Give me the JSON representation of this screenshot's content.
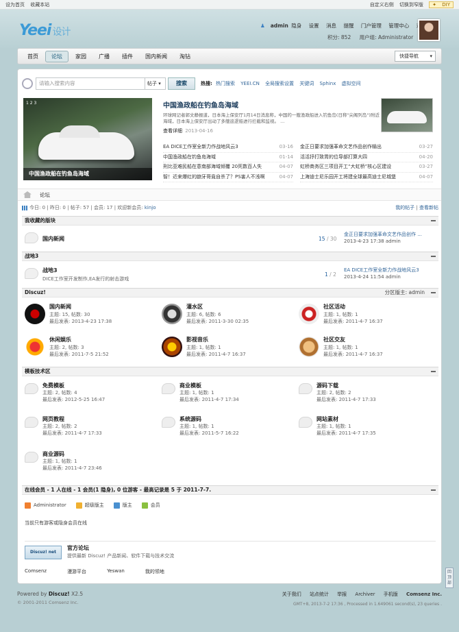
{
  "topbar": {
    "left": [
      "设为首页",
      "收藏本站"
    ],
    "right": [
      "自定义右侧",
      "切换到窄版"
    ],
    "diy": "DIY"
  },
  "header": {
    "logo": "Yeei",
    "logo_sub": "设计",
    "user_menu": [
      "admin",
      "隐身",
      "设置",
      "消息",
      "提醒",
      "门户管理",
      "管理中心",
      "退出"
    ],
    "credits": "积分: 852",
    "group": "用户组: Administrator"
  },
  "nav": {
    "items": [
      "首页",
      "论坛",
      "家园",
      "广播",
      "插件",
      "国内新闻",
      "淘钻"
    ],
    "active": 1,
    "quick": "快捷导航"
  },
  "search": {
    "placeholder": "请输入搜索内容",
    "type": "帖子",
    "button": "搜索",
    "hot_label": "热搜:",
    "hot": [
      "热门搜索",
      "YEEI.CN",
      "全局搜索设置",
      "关键词",
      "Sphinx",
      "虚拟空间"
    ]
  },
  "slide": {
    "pager": "1  2  3",
    "caption": "中国渔政船在钓鱼岛海域"
  },
  "feature": {
    "title": "中国渔政船在钓鱼岛海域",
    "desc": "环球网记者郭文静报道，日本海上保安厅1月14日消息称，中国的一艘渔政船进入钓鱼岛(日称\"尖阁列岛\")附近海域，日本海上保安厅出动了多艘巡逻船进行拦截和监视。 ...",
    "more": "查看详细",
    "date": "2013-04-16"
  },
  "news_left": [
    {
      "t": "EA DICE工作室全新力作战地风云3",
      "d": "03-16"
    },
    {
      "t": "中国渔政船在钓鱼岛海域",
      "d": "01-14"
    },
    {
      "t": "刑比亚难民船在意南部海域倾覆 20死数百人失",
      "d": "04-07"
    },
    {
      "t": "智！近来爆红的龅牙哥竟自杀了？PS害人不浅啊",
      "d": "04-07"
    }
  ],
  "news_right": [
    {
      "t": "金正日要求加强革命文艺作品创作输出",
      "d": "03-27"
    },
    {
      "t": "活活抒打致胃的位导部打算大四",
      "d": "04-20"
    },
    {
      "t": "虹桥商务区三项目开工“大虹桥”核心区建设",
      "d": "03-27"
    },
    {
      "t": "上海迪士尼乐园开工将建全球最高迪士尼城堡",
      "d": "04-07"
    }
  ],
  "breadcrumb": "论坛",
  "stats": {
    "text": "今日: 0  |  昨日: 0  |  帖子: 57  |  会员: 17  |  欢迎新会员: ",
    "new_member": "kinjo",
    "my_posts": "我的帖子",
    "new_posts": "查看新帖"
  },
  "fav": {
    "title": "我收藏的版块",
    "name": "国内新闻",
    "threads": "15",
    "posts": "30",
    "last_title": "金正日要求加强革命文艺作品创作 ...",
    "last_meta": "2013-4-23 17:38 admin"
  },
  "zd": {
    "title": "战地3",
    "name": "战地3",
    "desc": "DICE工作室开发制作,EA发行的射击游戏",
    "threads": "1",
    "posts": "2",
    "last_title": "EA DICE工作室全新力作战地风云3",
    "last_meta": "2013-4-24 11:54 admin"
  },
  "discuz": {
    "title": "Discuz!",
    "moderator": "分区版主: admin",
    "forums": [
      {
        "name": "国内新闻",
        "stat": "主题: 15, 帖数: 30",
        "last": "最后发表: 2013-4-23 17:38"
      },
      {
        "name": "灌水区",
        "stat": "主题: 6, 帖数: 6",
        "last": "最后发表: 2011-3-30 02:35"
      },
      {
        "name": "社区活动",
        "stat": "主题: 1, 帖数: 1",
        "last": "最后发表: 2011-4-7 16:37"
      },
      {
        "name": "休闲娱乐",
        "stat": "主题: 2, 帖数: 3",
        "last": "最后发表: 2011-7-5 21:52"
      },
      {
        "name": "影视音乐",
        "stat": "主题: 1, 帖数: 1",
        "last": "最后发表: 2011-4-7 16:37"
      },
      {
        "name": "社区交友",
        "stat": "主题: 1, 帖数: 1",
        "last": "最后发表: 2011-4-7 16:37"
      }
    ]
  },
  "template": {
    "title": "模板技术区",
    "forums": [
      {
        "name": "免费模板",
        "stat": "主题: 2, 帖数: 4",
        "last": "最后发表: 2012-5-25 16:47"
      },
      {
        "name": "商业模板",
        "stat": "主题: 1, 帖数: 1",
        "last": "最后发表: 2011-4-7 17:34"
      },
      {
        "name": "源码下载",
        "stat": "主题: 2, 帖数: 2",
        "last": "最后发表: 2011-4-7 17:33"
      },
      {
        "name": "网页教程",
        "stat": "主题: 2, 帖数: 2",
        "last": "最后发表: 2011-4-7 17:33"
      },
      {
        "name": "系统源码",
        "stat": "主题: 1, 帖数: 1",
        "last": "最后发表: 2011-5-7 16:22"
      },
      {
        "name": "网站素材",
        "stat": "主题: 1, 帖数: 1",
        "last": "最后发表: 2011-4-7 17:35"
      },
      {
        "name": "商业源码",
        "stat": "主题: 1, 帖数: 1",
        "last": "最后发表: 2011-4-7 23:46"
      }
    ]
  },
  "online": {
    "title": "在线会员 - 1 人在线 - 1 会员(1 隐身), 0 位游客 - 最高记录是 5 于 2011-7-7.",
    "legend": [
      "Administrator",
      "超级版主",
      "版主",
      "会员"
    ],
    "note": "当前只有游客或隐身会员在线"
  },
  "links": {
    "logo": "Discuz! net",
    "title": "官方论坛",
    "desc": "提供最新 Discuz! 产品新闻、软件下载与技术交流",
    "items": [
      "Comsenz",
      "漫游平台",
      "Yeswan",
      "我的领地"
    ]
  },
  "footer": {
    "powered": "Powered by",
    "product": "Discuz!",
    "version": "X2.5",
    "copyright": "© 2001-2011 Comsenz Inc.",
    "links": [
      "关于我们",
      "站点统计",
      "举报",
      "Archiver",
      "手机版",
      "Comsenz Inc."
    ],
    "gmt": "GMT+8, 2013-7-2 17:36 , Processed in 1.649061 second(s), 23 queries ."
  },
  "back_top": "回顶部"
}
